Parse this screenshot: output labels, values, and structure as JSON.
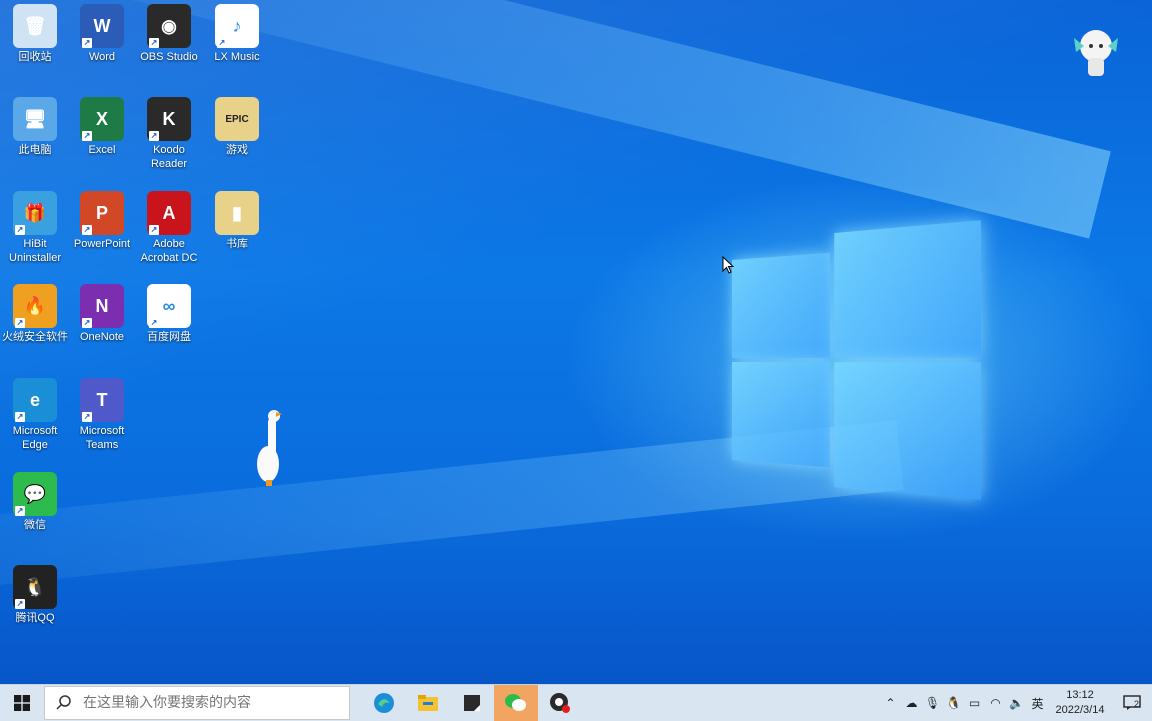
{
  "desktop": {
    "icons": [
      {
        "label": "回收站",
        "glyph": "🗑",
        "bg": "#cfe3f5",
        "shortcut": false
      },
      {
        "label": "Word",
        "glyph": "W",
        "bg": "#2b5cb8",
        "shortcut": true
      },
      {
        "label": "OBS Studio",
        "glyph": "◉",
        "bg": "#2a2a2a",
        "shortcut": true
      },
      {
        "label": "LX Music",
        "glyph": "♪",
        "bg": "#ffffff",
        "shortcut": true
      },
      {
        "label": "此电脑",
        "glyph": "🖥",
        "bg": "#5aa8e8",
        "shortcut": false
      },
      {
        "label": "Excel",
        "glyph": "X",
        "bg": "#1e7b45",
        "shortcut": true
      },
      {
        "label": "Koodo\nReader",
        "glyph": "K",
        "bg": "#2a2a2a",
        "shortcut": true
      },
      {
        "label": "游戏",
        "glyph": "EPIC",
        "bg": "#e8d28a",
        "shortcut": false
      },
      {
        "label": "HiBit\nUninstaller",
        "glyph": "🎁",
        "bg": "#3aa0e0",
        "shortcut": true
      },
      {
        "label": "PowerPoint",
        "glyph": "P",
        "bg": "#d24726",
        "shortcut": true
      },
      {
        "label": "Adobe\nAcrobat DC",
        "glyph": "A",
        "bg": "#c8141a",
        "shortcut": true
      },
      {
        "label": "书库",
        "glyph": "▮",
        "bg": "#e8d28a",
        "shortcut": false
      },
      {
        "label": "火绒安全软件",
        "glyph": "🔥",
        "bg": "#f0a020",
        "shortcut": true
      },
      {
        "label": "OneNote",
        "glyph": "N",
        "bg": "#7b2fb0",
        "shortcut": true
      },
      {
        "label": "百度网盘",
        "glyph": "∞",
        "bg": "#ffffff",
        "shortcut": true
      },
      {
        "label": "Microsoft\nEdge",
        "glyph": "e",
        "bg": "#1a8fd8",
        "shortcut": true
      },
      {
        "label": "Microsoft\nTeams",
        "glyph": "T",
        "bg": "#5059c9",
        "shortcut": true
      },
      {
        "label": "微信",
        "glyph": "💬",
        "bg": "#2dbb4e",
        "shortcut": true
      },
      {
        "label": "腾讯QQ",
        "glyph": "🐧",
        "bg": "#222222",
        "shortcut": true
      }
    ]
  },
  "taskbar": {
    "search_placeholder": "在这里输入你要搜索的内容",
    "apps": [
      "edge-icon",
      "file-explorer-icon",
      "sticky-notes-icon",
      "wechat-icon",
      "obs-icon"
    ],
    "tray": {
      "input_method": "英",
      "time": "13:12",
      "date": "2022/3/14",
      "notification_count": "2"
    }
  }
}
